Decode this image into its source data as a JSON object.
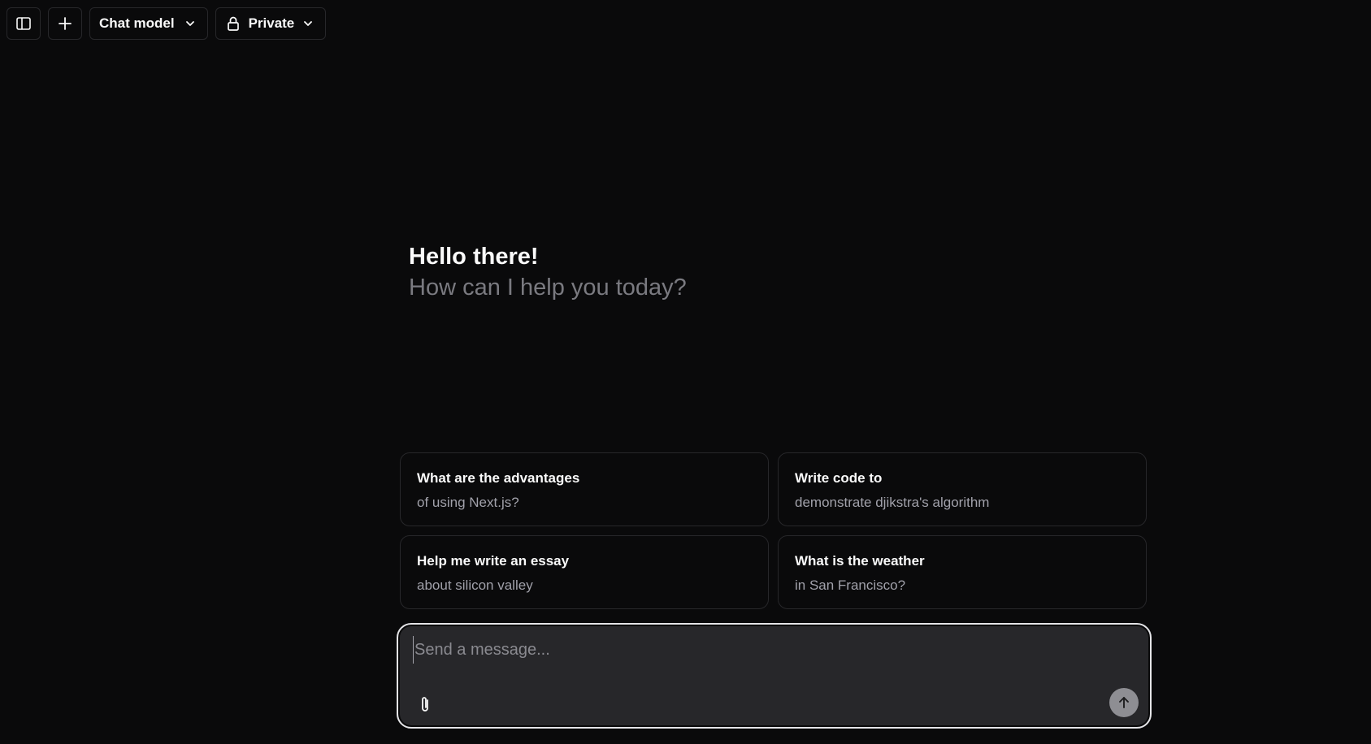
{
  "topbar": {
    "sidebar_toggle_icon": "panel-left-icon",
    "new_chat_icon": "plus-icon",
    "model_selector": {
      "label": "Chat model",
      "icon": "chevron-down-icon"
    },
    "visibility_selector": {
      "label": "Private",
      "leading_icon": "lock-icon",
      "icon": "chevron-down-icon"
    }
  },
  "greeting": {
    "title": "Hello there!",
    "subtitle": "How can I help you today?"
  },
  "suggestions": [
    {
      "title": "What are the advantages",
      "subtitle": "of using Next.js?"
    },
    {
      "title": "Write code to",
      "subtitle": "demonstrate djikstra's algorithm"
    },
    {
      "title": "Help me write an essay",
      "subtitle": "about silicon valley"
    },
    {
      "title": "What is the weather",
      "subtitle": "in San Francisco?"
    }
  ],
  "composer": {
    "placeholder": "Send a message...",
    "value": "",
    "attach_icon": "paperclip-icon",
    "send_icon": "arrow-up-icon"
  },
  "colors": {
    "background": "#0a0a0b",
    "border": "#27272a",
    "composer_bg": "#27272a",
    "muted_text": "#a1a1aa",
    "send_button": "#8e8e93"
  }
}
